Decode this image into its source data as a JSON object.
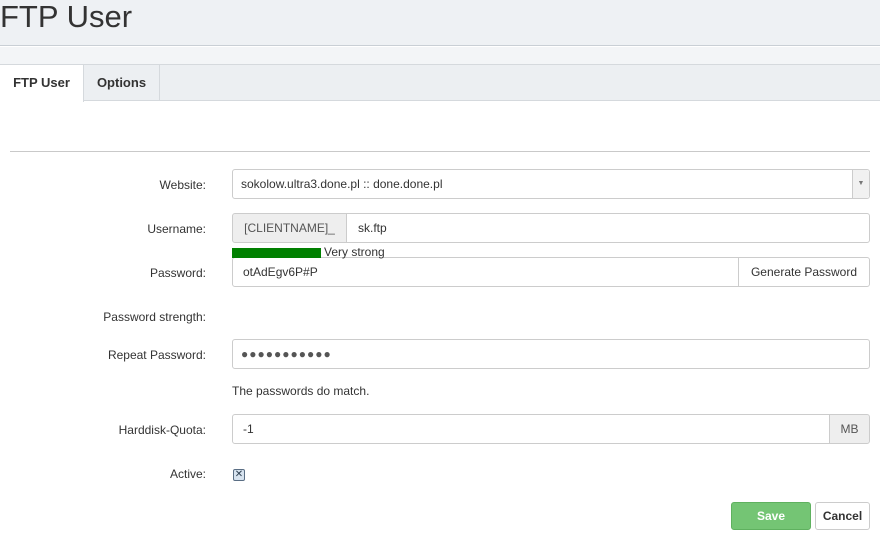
{
  "page": {
    "title": "FTP User"
  },
  "tabs": [
    {
      "label": "FTP User",
      "active": true
    },
    {
      "label": "Options",
      "active": false
    }
  ],
  "form": {
    "website": {
      "label": "Website:",
      "value": "sokolow.ultra3.done.pl :: done.done.pl",
      "arrow": "▼"
    },
    "username": {
      "label": "Username:",
      "prefix": "[CLIENTNAME]_",
      "value": "sk.ftp"
    },
    "password": {
      "label": "Password:",
      "value": "otAdEgv6P#P",
      "generate_label": "Generate Password"
    },
    "strength": {
      "label": "Password strength:",
      "text": "Very strong",
      "color": "#008000"
    },
    "repeat_password": {
      "label": "Repeat Password:",
      "masked_value": "●●●●●●●●●●●"
    },
    "match_message": "The passwords do match.",
    "quota": {
      "label": "Harddisk-Quota:",
      "value": "-1",
      "unit": "MB"
    },
    "active": {
      "label": "Active:",
      "checked": true,
      "mark": "✕"
    }
  },
  "buttons": {
    "save": "Save",
    "cancel": "Cancel"
  },
  "colors": {
    "save_bg": "#74c574",
    "strength_bar": "#008000"
  }
}
